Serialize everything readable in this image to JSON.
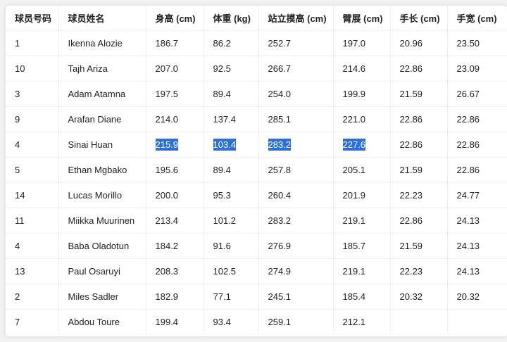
{
  "table": {
    "headers": [
      "球员号码",
      "球员姓名",
      "身高 (cm)",
      "体重 (kg)",
      "站立摸高 (cm)",
      "臂展 (cm)",
      "手长 (cm)",
      "手宽 (cm)"
    ],
    "rows": [
      [
        "1",
        "Ikenna Alozie",
        "186.7",
        "86.2",
        "252.7",
        "197.0",
        "20.96",
        "23.50"
      ],
      [
        "10",
        "Tajh Ariza",
        "207.0",
        "92.5",
        "266.7",
        "214.6",
        "22.86",
        "23.09"
      ],
      [
        "3",
        "Adam Atamna",
        "197.5",
        "89.4",
        "254.0",
        "199.9",
        "21.59",
        "26.67"
      ],
      [
        "9",
        "Arafan Diane",
        "214.0",
        "137.4",
        "285.1",
        "221.0",
        "22.86",
        "22.86"
      ],
      [
        "4",
        "Sinai Huan",
        "215.9",
        "103.4",
        "283.2",
        "227.6",
        "22.86",
        "22.86"
      ],
      [
        "5",
        "Ethan Mgbako",
        "195.6",
        "89.4",
        "257.8",
        "205.1",
        "21.59",
        "22.86"
      ],
      [
        "14",
        "Lucas Morillo",
        "200.0",
        "95.3",
        "260.4",
        "201.9",
        "22.23",
        "24.77"
      ],
      [
        "11",
        "Miikka Muurinen",
        "213.4",
        "101.2",
        "283.2",
        "219.1",
        "22.86",
        "24.13"
      ],
      [
        "4",
        "Baba Oladotun",
        "184.2",
        "91.6",
        "276.9",
        "185.7",
        "21.59",
        "24.13"
      ],
      [
        "13",
        "Paul Osaruyi",
        "208.3",
        "102.5",
        "274.9",
        "219.1",
        "22.23",
        "24.13"
      ],
      [
        "2",
        "Miles Sadler",
        "182.9",
        "77.1",
        "245.1",
        "185.4",
        "20.32",
        "20.32"
      ],
      [
        "7",
        "Abdou Toure",
        "199.4",
        "93.4",
        "259.1",
        "212.1",
        "",
        ""
      ]
    ],
    "selected_row": 4,
    "selected_cols": [
      2,
      3,
      4,
      5
    ]
  },
  "colors": {
    "selection": "#2d6fd8",
    "grid": "#eeeeee",
    "background": "#f2f2f2"
  }
}
